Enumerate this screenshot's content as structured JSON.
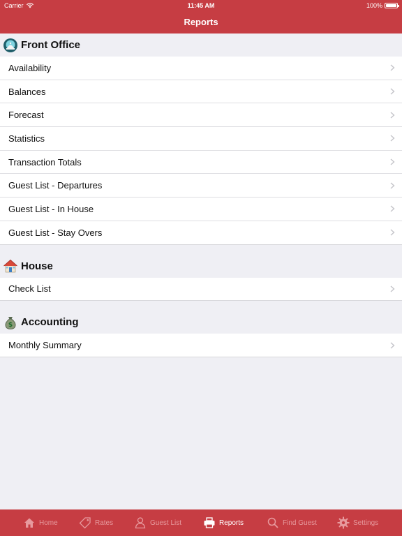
{
  "status_bar": {
    "carrier": "Carrier",
    "time": "11:45 AM",
    "battery": "100%"
  },
  "nav": {
    "title": "Reports"
  },
  "sections": [
    {
      "title": "Front Office",
      "icon": "concierge-bell-icon",
      "items": [
        "Availability",
        "Balances",
        "Forecast",
        "Statistics",
        "Transaction Totals",
        "Guest List - Departures",
        "Guest List - In House",
        "Guest List - Stay Overs"
      ]
    },
    {
      "title": "House",
      "icon": "house-icon",
      "items": [
        "Check List"
      ]
    },
    {
      "title": "Accounting",
      "icon": "money-bag-icon",
      "items": [
        "Monthly Summary"
      ]
    }
  ],
  "tabbar": {
    "tabs": [
      {
        "label": "Home",
        "icon": "home-icon",
        "active": false
      },
      {
        "label": "Rates",
        "icon": "tag-icon",
        "active": false
      },
      {
        "label": "Guest List",
        "icon": "person-icon",
        "active": false
      },
      {
        "label": "Reports",
        "icon": "printer-icon",
        "active": true
      },
      {
        "label": "Find Guest",
        "icon": "search-icon",
        "active": false
      },
      {
        "label": "Settings",
        "icon": "gear-icon",
        "active": false
      }
    ]
  },
  "colors": {
    "brand": "#c63d43",
    "background": "#efeff4",
    "inactive_tab": "#e79a9e"
  }
}
